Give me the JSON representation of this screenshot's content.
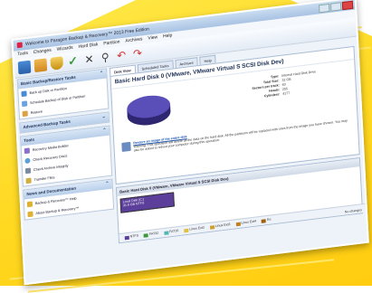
{
  "window": {
    "title": "Welcome to Paragon Backup & Recovery™ 2013 Free Edition"
  },
  "menu": [
    "Tools",
    "Changes",
    "Wizards",
    "Hard Disk",
    "Partition",
    "Archives",
    "View",
    "Help"
  ],
  "sidebar": {
    "panels": [
      {
        "title": "Basic Backup/Restore Tasks",
        "items": [
          "Back up Disk or Partition",
          "Schedule Backup of Disk or Partition",
          "Restore"
        ]
      },
      {
        "title": "Advanced Backup Tasks",
        "items": []
      },
      {
        "title": "Tools",
        "items": [
          "Recovery Media Builder",
          "Check Recovery Discs",
          "Check Archive Integrity",
          "Transfer Files"
        ]
      },
      {
        "title": "News and Documentation",
        "items": [
          "Backup & Recovery™ Help",
          "About Backup & Recovery™"
        ]
      }
    ]
  },
  "tabs": [
    "Disk View",
    "Scheduled Tasks",
    "Archives",
    "Help"
  ],
  "disk": {
    "title": "Basic Hard Disk 0 (VMware, VMware Virtual S SCSI Disk Dev)",
    "props": [
      {
        "key": "Type:",
        "value": "Internal Hard Disk Drive"
      },
      {
        "key": "Total Size:",
        "value": "32 GB"
      },
      {
        "key": "Sectors per track:",
        "value": "63"
      },
      {
        "key": "Heads:",
        "value": "255"
      },
      {
        "key": "Cylinders:",
        "value": "4177"
      }
    ],
    "warning_link": "Restore an image of the entire disk",
    "warning_text": "Warning: This operation will delete all the data on the hard disk. All the partitions will be replaced with ones from the image you have chosen. You may also be asked to reboot your computer during this operation.",
    "map_title": "Basic Hard Disk 0 (VMware, VMware Virtual S SCSI Disk Dev)",
    "partition_label": "Local Disk (C:)",
    "partition_size": "31.9 GB NTFS"
  },
  "legend": [
    "NTFS",
    "FAT32",
    "FAT16",
    "Linux Ext2",
    "Linux Ext3",
    "Linux Ext4",
    "Re"
  ],
  "status": "No changes",
  "colors": {
    "pie": "#4a3e9a",
    "partition": "#5b3f9a",
    "background": "#ffd820"
  }
}
